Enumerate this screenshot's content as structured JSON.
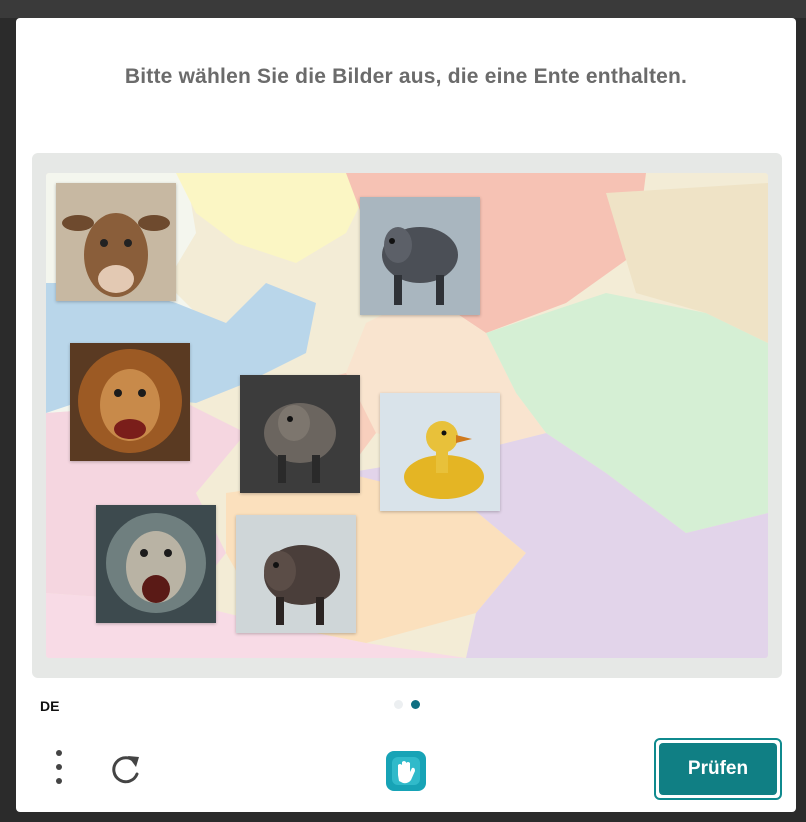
{
  "captcha": {
    "prompt": "Bitte wählen Sie die Bilder aus, die eine Ente enthalten.",
    "language": "DE",
    "submit_label": "Prüfen",
    "current_page": 2,
    "total_pages": 2
  },
  "tiles": [
    {
      "name": "tile-cow",
      "depicts": "cow"
    },
    {
      "name": "tile-boar-1",
      "depicts": "boar"
    },
    {
      "name": "tile-lion-1",
      "depicts": "lion"
    },
    {
      "name": "tile-boar-2",
      "depicts": "boar"
    },
    {
      "name": "tile-duck",
      "depicts": "duck"
    },
    {
      "name": "tile-lion-2",
      "depicts": "lion"
    },
    {
      "name": "tile-boar-3",
      "depicts": "boar"
    }
  ],
  "icons": {
    "menu": "vertical-dots-icon",
    "refresh": "refresh-icon",
    "logo": "hand-logo-icon"
  },
  "colors": {
    "accent": "#107f84",
    "prompt_text": "#6b6b6b",
    "active_dot": "#0f6f82"
  }
}
